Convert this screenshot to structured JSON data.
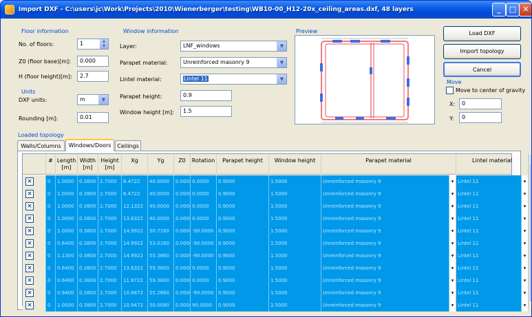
{
  "window": {
    "title": "Import DXF - C:\\users\\jc\\Work\\Projects\\2010\\Wienerberger\\testing\\WB10-00_H12-20x_ceiling_areas.dxf, 48 layers",
    "min_glyph": "_",
    "max_glyph": "□",
    "close_glyph": "✕"
  },
  "floor_info": {
    "title": "Floor information",
    "num_floors_label": "No. of floors:",
    "num_floors_value": "1",
    "z0_label": "Z0 (floor base)[m]:",
    "z0_value": "0.000",
    "h_label": "H (floor height)[m]:",
    "h_value": "2.7"
  },
  "units": {
    "title": "Units",
    "dxf_units_label": "DXF units:",
    "dxf_units_value": "m",
    "rounding_label": "Rounding [m]:",
    "rounding_value": "0.01"
  },
  "window_info": {
    "title": "Window information",
    "layer_label": "Layer:",
    "layer_value": "LNF_windows",
    "parapet_material_label": "Parapet material:",
    "parapet_material_value": "Unreinforced masonry 9",
    "lintel_material_label": "Lintel material:",
    "lintel_material_value": "Lintel 11",
    "parapet_height_label": "Parapet height:",
    "parapet_height_value": "0.9",
    "window_height_label": "Window height [m]:",
    "window_height_value": "1.5"
  },
  "preview": {
    "title": "Preview"
  },
  "buttons": {
    "load_dxf": "Load DXF",
    "import_topology": "Import topology",
    "cancel": "Cancel"
  },
  "move": {
    "title": "Move",
    "center_label": "Move to center of gravity",
    "x_label": "X:",
    "x_value": "0",
    "y_label": "Y:",
    "y_value": "0"
  },
  "topology": {
    "title": "Loaded topology",
    "tabs": [
      {
        "label": "Walls/Columns"
      },
      {
        "label": "Windows/Doors"
      },
      {
        "label": "Ceilings"
      }
    ],
    "headers": {
      "num": "#",
      "length": "Length [m]",
      "width": "Width [m]",
      "height": "Height [m]",
      "xg": "Xg",
      "yg": "Yg",
      "z0": "Z0",
      "rotation": "Rotation",
      "parapet_height": "Parapet height",
      "window_height": "Window height",
      "parapet_material": "Parapet material",
      "lintel_material": "Lintel material"
    },
    "rows": [
      {
        "num": "0",
        "length": "1.0000",
        "width": "0.3800",
        "height": "2.7000",
        "xg": "6.4722",
        "yg": "40.0000",
        "z0": "0.0000",
        "rotation": "0.0000",
        "ph": "0.9000",
        "wh": "1.5000",
        "pm": "Unreinforced masonry 9",
        "lm": "Lintel 11"
      },
      {
        "num": "0",
        "length": "1.0000",
        "width": "0.3800",
        "height": "2.7000",
        "xg": "6.4722",
        "yg": "40.0000",
        "z0": "0.0000",
        "rotation": "0.0000",
        "ph": "0.9000",
        "wh": "1.5000",
        "pm": "Unreinforced masonry 9",
        "lm": "Lintel 11"
      },
      {
        "num": "0",
        "length": "1.0000",
        "width": "0.3800",
        "height": "2.7000",
        "xg": "12.1322",
        "yg": "40.0000",
        "z0": "0.0000",
        "rotation": "0.0000",
        "ph": "0.9000",
        "wh": "1.5000",
        "pm": "Unreinforced masonry 9",
        "lm": "Lintel 11"
      },
      {
        "num": "0",
        "length": "1.0000",
        "width": "0.3800",
        "height": "2.7000",
        "xg": "13.6322",
        "yg": "40.0000",
        "z0": "0.0000",
        "rotation": "0.0000",
        "ph": "0.9000",
        "wh": "1.5000",
        "pm": "Unreinforced masonry 9",
        "lm": "Lintel 11"
      },
      {
        "num": "0",
        "length": "1.0000",
        "width": "0.3800",
        "height": "2.7000",
        "xg": "14.9922",
        "yg": "50.7160",
        "z0": "0.0000",
        "rotation": "-90.0000",
        "ph": "0.9000",
        "wh": "1.5000",
        "pm": "Unreinforced masonry 9",
        "lm": "Lintel 11"
      },
      {
        "num": "0",
        "length": "0.6400",
        "width": "0.3800",
        "height": "2.7000",
        "xg": "14.9922",
        "yg": "53.0160",
        "z0": "0.0000",
        "rotation": "-90.0000",
        "ph": "0.9000",
        "wh": "1.5000",
        "pm": "Unreinforced masonry 9",
        "lm": "Lintel 11"
      },
      {
        "num": "0",
        "length": "1.1300",
        "width": "0.3800",
        "height": "2.7000",
        "xg": "14.9922",
        "yg": "55.3660",
        "z0": "0.0000",
        "rotation": "-90.0000",
        "ph": "0.9000",
        "wh": "1.5000",
        "pm": "Unreinforced masonry 9",
        "lm": "Lintel 11"
      },
      {
        "num": "0",
        "length": "0.6400",
        "width": "0.3800",
        "height": "2.7000",
        "xg": "13.6322",
        "yg": "59.3600",
        "z0": "0.0000",
        "rotation": "0.0000",
        "ph": "0.9000",
        "wh": "1.5000",
        "pm": "Unreinforced masonry 9",
        "lm": "Lintel 11"
      },
      {
        "num": "0",
        "length": "0.6400",
        "width": "0.3800",
        "height": "2.7000",
        "xg": "11.8722",
        "yg": "59.3600",
        "z0": "0.0000",
        "rotation": "0.0000",
        "ph": "0.9000",
        "wh": "1.5000",
        "pm": "Unreinforced masonry 9",
        "lm": "Lintel 11"
      },
      {
        "num": "0",
        "length": "0.9400",
        "width": "0.3800",
        "height": "2.7000",
        "xg": "10.9472",
        "yg": "55.2660",
        "z0": "0.0000",
        "rotation": "-90.0000",
        "ph": "0.9000",
        "wh": "1.5000",
        "pm": "Unreinforced masonry 9",
        "lm": "Lintel 11"
      },
      {
        "num": "0",
        "length": "1.0000",
        "width": "0.3800",
        "height": "2.7000",
        "xg": "10.9472",
        "yg": "50.0090",
        "z0": "0.0000",
        "rotation": "90.0000",
        "ph": "0.9000",
        "wh": "1.5000",
        "pm": "Unreinforced masonry 9",
        "lm": "Lintel 11"
      }
    ]
  }
}
